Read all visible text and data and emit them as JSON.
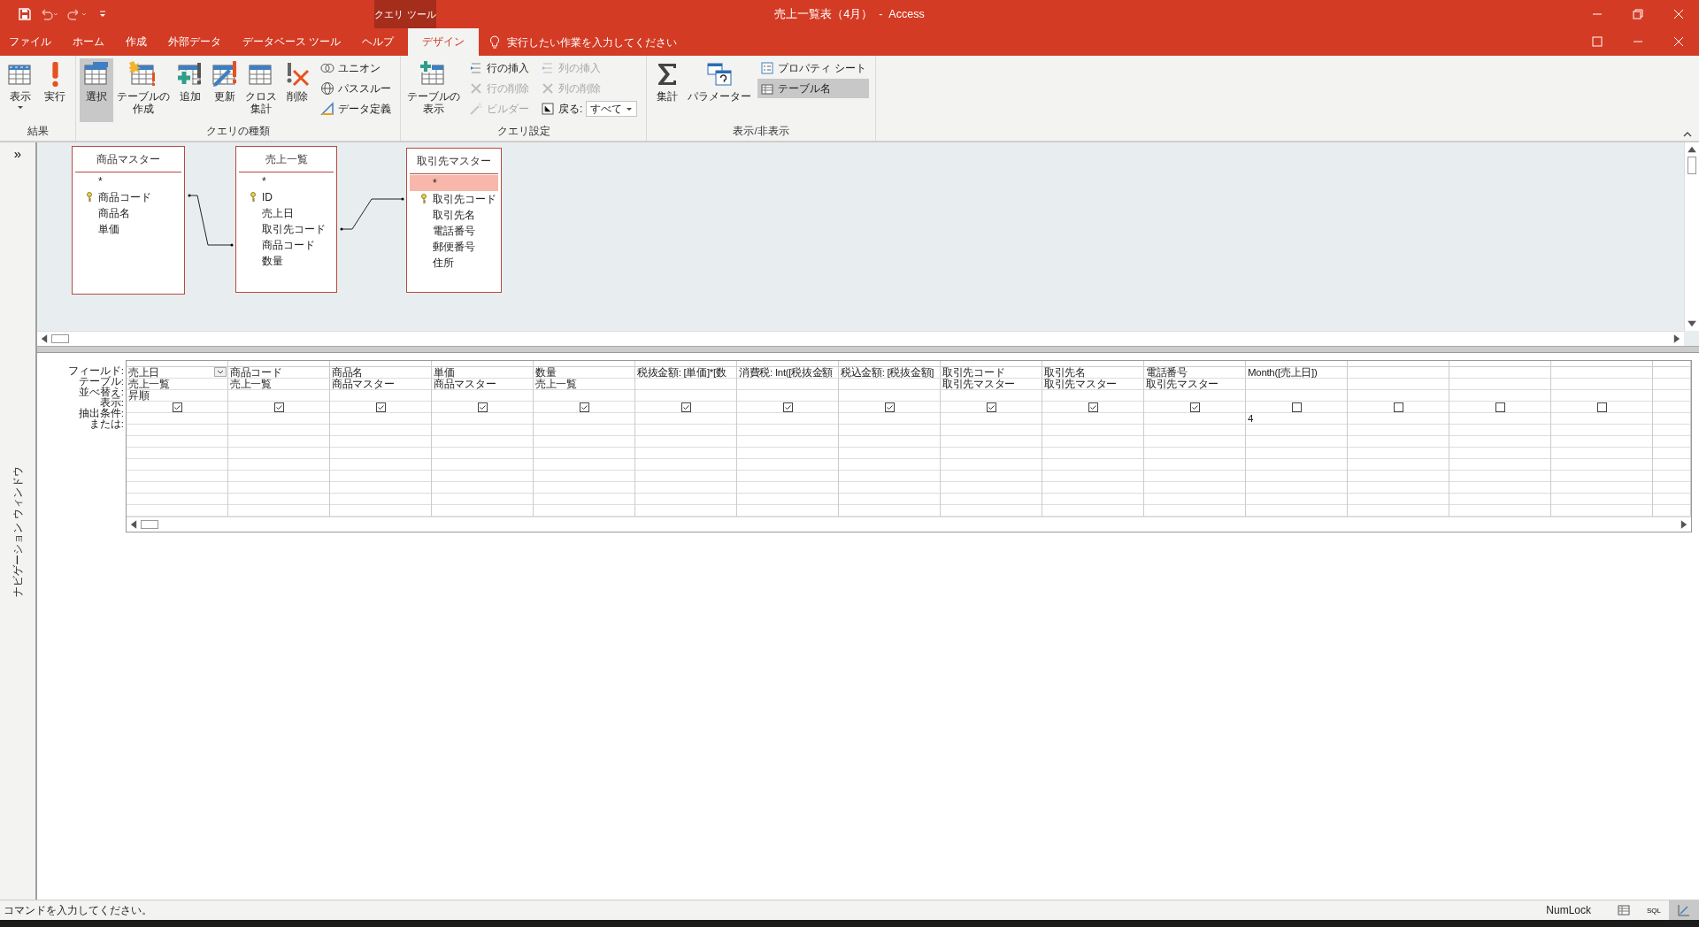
{
  "title_bar": {
    "title": "売上一覧表（4月）  -  Access",
    "context_label": "クエリ ツール"
  },
  "tabs": [
    {
      "label": "ファイル",
      "selected": false
    },
    {
      "label": "ホーム",
      "selected": false
    },
    {
      "label": "作成",
      "selected": false
    },
    {
      "label": "外部データ",
      "selected": false
    },
    {
      "label": "データベース ツール",
      "selected": false
    },
    {
      "label": "ヘルプ",
      "selected": false
    },
    {
      "label": "デザイン",
      "selected": true
    }
  ],
  "tell_me": {
    "placeholder": "実行したい作業を入力してください"
  },
  "ribbon": {
    "groups": [
      {
        "label": "結果",
        "items": [
          {
            "kind": "large",
            "label": "表示",
            "dropdown": true,
            "selected": false
          },
          {
            "kind": "large",
            "label": "実行",
            "dropdown": false,
            "selected": false
          }
        ]
      },
      {
        "label": "クエリの種類",
        "items": [
          {
            "kind": "large",
            "label": "選択",
            "dropdown": false,
            "selected": true
          },
          {
            "kind": "large",
            "label": "テーブルの作成",
            "dropdown": false,
            "selected": false
          },
          {
            "kind": "large",
            "label": "追加",
            "dropdown": false,
            "selected": false
          },
          {
            "kind": "large",
            "label": "更新",
            "dropdown": false,
            "selected": false
          },
          {
            "kind": "large",
            "label": "クロス集計",
            "dropdown": false,
            "selected": false
          },
          {
            "kind": "large",
            "label": "削除",
            "dropdown": false,
            "selected": false
          },
          {
            "kind": "stack",
            "items": [
              {
                "kind": "small",
                "label": "ユニオン",
                "disabled": false,
                "selected": false
              },
              {
                "kind": "small",
                "label": "パススルー",
                "disabled": false,
                "selected": false
              },
              {
                "kind": "small",
                "label": "データ定義",
                "disabled": false,
                "selected": false
              }
            ]
          }
        ]
      },
      {
        "label": "クエリ設定",
        "items": [
          {
            "kind": "large",
            "label": "テーブルの表示",
            "dropdown": false,
            "selected": false
          },
          {
            "kind": "stack",
            "items": [
              {
                "kind": "small",
                "label": "行の挿入",
                "disabled": false,
                "selected": false
              },
              {
                "kind": "small",
                "label": "行の削除",
                "disabled": true,
                "selected": false
              },
              {
                "kind": "small",
                "label": "ビルダー",
                "disabled": true,
                "selected": false
              }
            ]
          },
          {
            "kind": "stack",
            "items": [
              {
                "kind": "small",
                "label": "列の挿入",
                "disabled": true,
                "selected": false
              },
              {
                "kind": "small",
                "label": "列の削除",
                "disabled": true,
                "selected": false
              },
              {
                "kind": "combo",
                "label": "戻る:",
                "value": "すべて"
              }
            ]
          }
        ]
      },
      {
        "label": "表示/非表示",
        "items": [
          {
            "kind": "large",
            "label": "集計",
            "dropdown": false,
            "selected": false
          },
          {
            "kind": "large",
            "label": "パラメーター",
            "dropdown": false,
            "selected": false
          },
          {
            "kind": "stack",
            "items": [
              {
                "kind": "small",
                "label": "プロパティ シート",
                "disabled": false,
                "selected": false
              },
              {
                "kind": "small",
                "label": "テーブル名",
                "disabled": false,
                "selected": true
              }
            ]
          }
        ]
      }
    ]
  },
  "navigation_pane": {
    "label": "ナビゲーション ウィンドウ",
    "toggle": "»"
  },
  "tables": [
    {
      "title": "商品マスター",
      "fields": [
        {
          "name": "*",
          "key": false,
          "selected": false
        },
        {
          "name": "商品コード",
          "key": true,
          "selected": false
        },
        {
          "name": "商品名",
          "key": false,
          "selected": false
        },
        {
          "name": "単価",
          "key": false,
          "selected": false
        }
      ]
    },
    {
      "title": "売上一覧",
      "fields": [
        {
          "name": "*",
          "key": false,
          "selected": false
        },
        {
          "name": "ID",
          "key": true,
          "selected": false
        },
        {
          "name": "売上日",
          "key": false,
          "selected": false
        },
        {
          "name": "取引先コード",
          "key": false,
          "selected": false
        },
        {
          "name": "商品コード",
          "key": false,
          "selected": false
        },
        {
          "name": "数量",
          "key": false,
          "selected": false
        }
      ]
    },
    {
      "title": "取引先マスター",
      "fields": [
        {
          "name": "*",
          "key": false,
          "selected": true
        },
        {
          "name": "取引先コード",
          "key": true,
          "selected": false
        },
        {
          "name": "取引先名",
          "key": false,
          "selected": false
        },
        {
          "name": "電話番号",
          "key": false,
          "selected": false
        },
        {
          "name": "郵便番号",
          "key": false,
          "selected": false
        },
        {
          "name": "住所",
          "key": false,
          "selected": false
        }
      ]
    }
  ],
  "grid": {
    "row_labels": [
      "フィールド:",
      "テーブル:",
      "並べ替え:",
      "表示:",
      "抽出条件:",
      "または:"
    ],
    "columns": [
      {
        "field": "売上日",
        "table": "売上一覧",
        "sort": "昇順",
        "show": true,
        "active": true
      },
      {
        "field": "商品コード",
        "table": "売上一覧",
        "show": true,
        "active": false
      },
      {
        "field": "商品名",
        "table": "商品マスター",
        "show": true,
        "active": false
      },
      {
        "field": "単価",
        "table": "商品マスター",
        "show": true,
        "active": false
      },
      {
        "field": "数量",
        "table": "売上一覧",
        "show": true,
        "active": false
      },
      {
        "field": "税抜金額: [単価]*[数",
        "show": true,
        "active": false
      },
      {
        "field": "消費税: Int([税抜金額",
        "show": true,
        "active": false
      },
      {
        "field": "税込金額: [税抜金額]",
        "show": true,
        "active": false
      },
      {
        "field": "取引先コード",
        "table": "取引先マスター",
        "show": true,
        "active": false
      },
      {
        "field": "取引先名",
        "table": "取引先マスター",
        "show": true,
        "active": false
      },
      {
        "field": "電話番号",
        "table": "取引先マスター",
        "show": true,
        "active": false
      },
      {
        "field": "Month([売上日])",
        "show": false,
        "criteria": "4",
        "active": false
      },
      {
        "show": false,
        "active": false
      },
      {
        "show": false,
        "active": false
      },
      {
        "show": false,
        "active": false
      }
    ]
  },
  "status_bar": {
    "message": "コマンドを入力してください。",
    "numlock": "NumLock",
    "views": [
      {
        "kind": "datasheet",
        "selected": false
      },
      {
        "kind": "sql",
        "label": "SQL",
        "selected": false
      },
      {
        "kind": "design",
        "selected": true
      }
    ]
  }
}
